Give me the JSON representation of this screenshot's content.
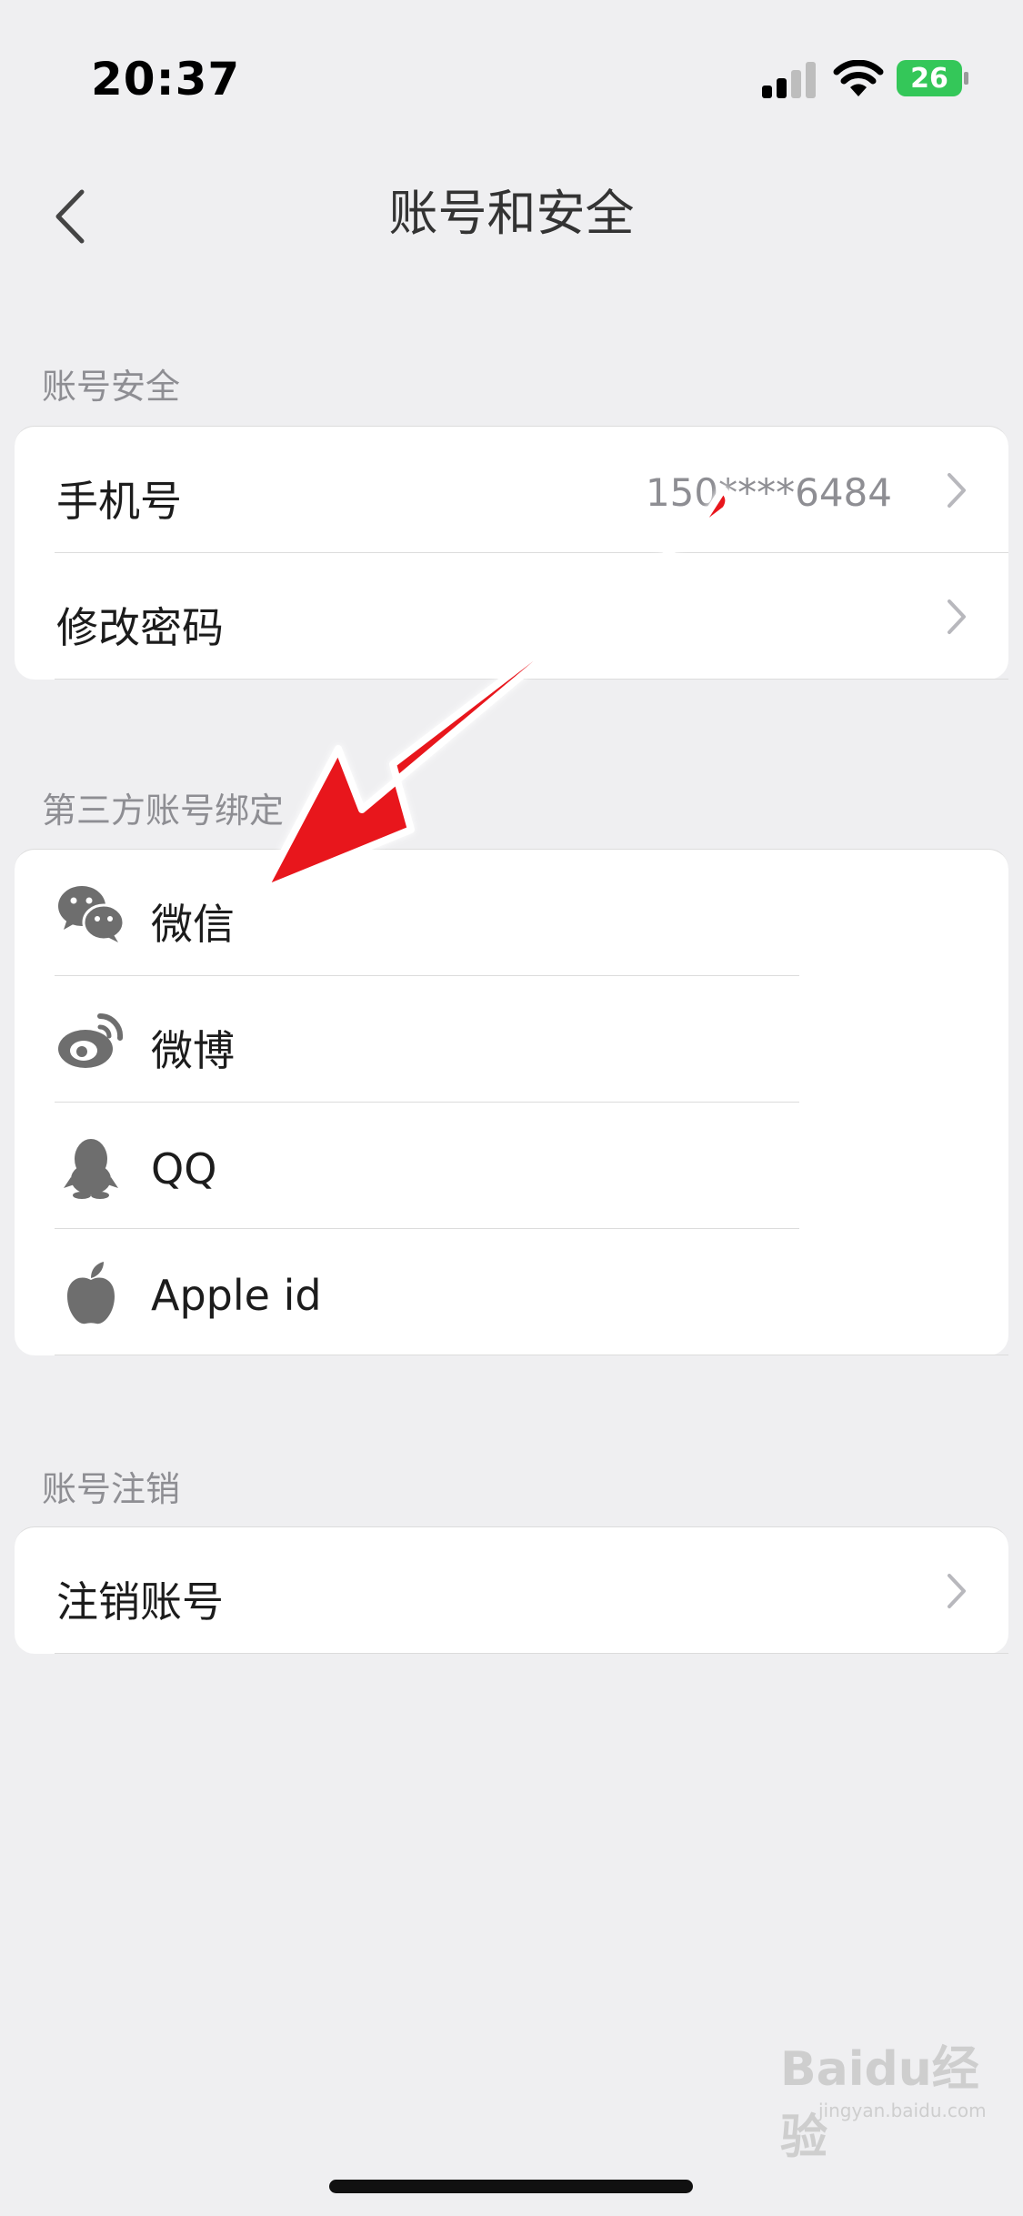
{
  "status_bar": {
    "time": "20:37",
    "battery": "26"
  },
  "nav": {
    "title": "账号和安全"
  },
  "account_security": {
    "header": "账号安全",
    "phone": {
      "label": "手机号",
      "value": "150****6484"
    },
    "password": {
      "label": "修改密码"
    }
  },
  "third_party": {
    "header": "第三方账号绑定",
    "items": [
      {
        "label": "微信",
        "icon": "wechat-icon"
      },
      {
        "label": "微博",
        "icon": "weibo-icon"
      },
      {
        "label": "QQ",
        "icon": "qq-penguin-icon"
      },
      {
        "label": "Apple id",
        "icon": "apple-icon"
      }
    ]
  },
  "deactivation": {
    "header": "账号注销",
    "item": {
      "label": "注销账号"
    }
  },
  "watermark": {
    "brand": "Baidu经验",
    "url": "jingyan.baidu.com"
  },
  "colors": {
    "background": "#efeff1",
    "arrow": "#e8121a",
    "battery_green": "#34c759"
  }
}
